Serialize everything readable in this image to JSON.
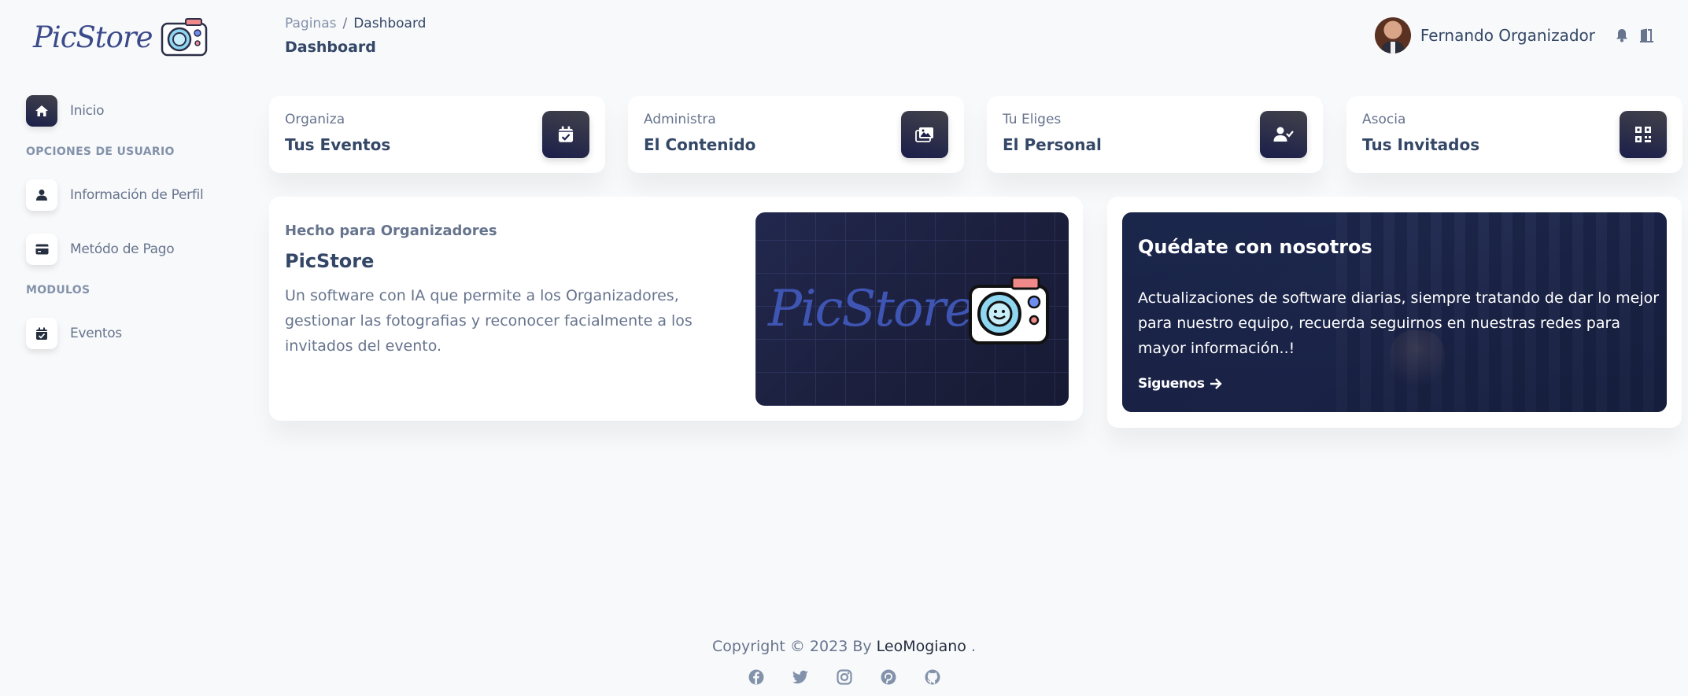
{
  "brand": {
    "name": "PicStore",
    "accent": "#344767",
    "gradient_dark": "#1b1e4a"
  },
  "sidebar": {
    "items": [
      {
        "label": "Inicio",
        "icon": "home-icon",
        "active": true
      },
      {
        "label": "Información de Perfil",
        "icon": "user-icon",
        "active": false
      },
      {
        "label": "Metódo de Pago",
        "icon": "credit-card-icon",
        "active": false
      },
      {
        "label": "Eventos",
        "icon": "calendar-check-icon",
        "active": false
      }
    ],
    "sections": {
      "user_options": "OPCIONES DE USUARIO",
      "modules": "MODULOS"
    }
  },
  "header": {
    "breadcrumb": {
      "root": "Paginas",
      "separator": "/",
      "current": "Dashboard"
    },
    "title": "Dashboard",
    "user_name": "Fernando Organizador",
    "icons": [
      "bell-icon",
      "logout-icon"
    ]
  },
  "stats": [
    {
      "small": "Organiza",
      "big": "Tus Eventos",
      "icon": "calendar-check-icon"
    },
    {
      "small": "Administra",
      "big": "El Contenido",
      "icon": "images-icon"
    },
    {
      "small": "Tu Eliges",
      "big": "El Personal",
      "icon": "user-check-icon"
    },
    {
      "small": "Asocia",
      "big": "Tus Invitados",
      "icon": "qrcode-icon"
    }
  ],
  "info_card": {
    "pre": "Hecho para Organizadores",
    "title": "PicStore",
    "description": "Un software con IA que permite a los Organizadores, gestionar las fotografias y reconocer facialmente a los invitados del evento.",
    "banner_text": "PicStore"
  },
  "side_card": {
    "title": "Quédate con nosotros",
    "description": "Actualizaciones de software diarias, siempre tratando de dar lo mejor para nuestro equipo, recuerda seguirnos en nuestras redes para mayor información..!",
    "link": "Siguenos"
  },
  "footer": {
    "copyright_prefix": "Copyright © 2023 By",
    "author": "LeoMogiano",
    "suffix": ".",
    "socials": [
      "facebook-icon",
      "twitter-icon",
      "instagram-icon",
      "pinterest-icon",
      "github-icon"
    ]
  }
}
